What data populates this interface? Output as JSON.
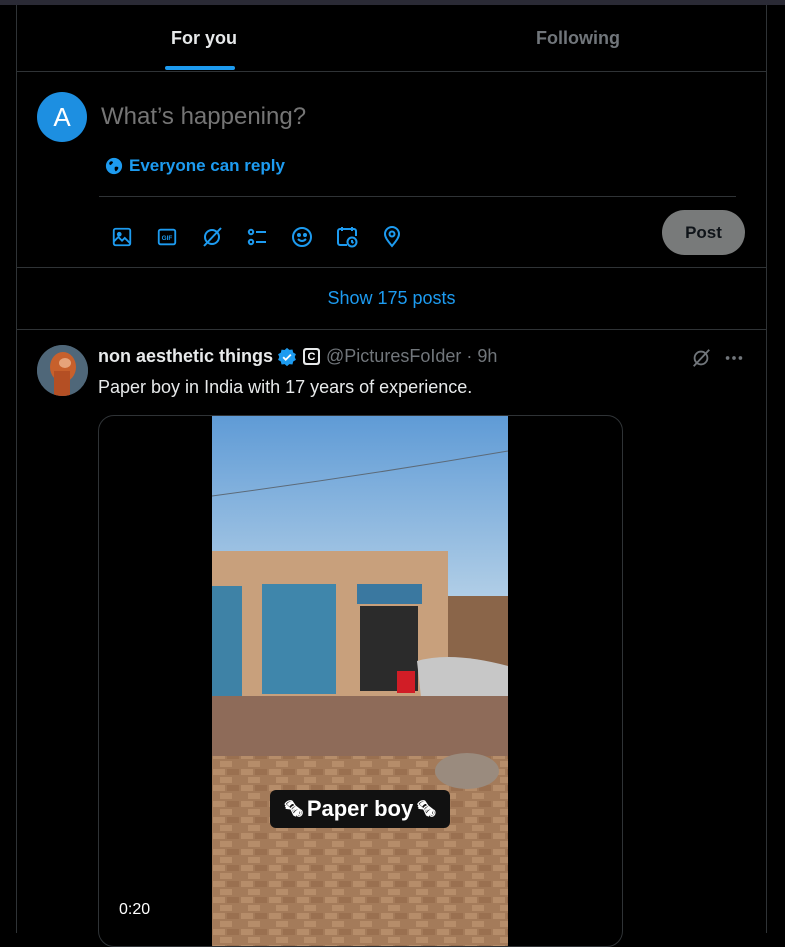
{
  "tabs": {
    "for_you": "For you",
    "following": "Following"
  },
  "composer": {
    "avatar_letter": "A",
    "placeholder": "What’s happening?",
    "reply_setting": "Everyone can reply",
    "post_label": "Post",
    "tools": [
      "image-icon",
      "gif-icon",
      "grok-icon",
      "poll-icon",
      "emoji-icon",
      "schedule-icon",
      "location-icon"
    ],
    "gif_text": "GIF"
  },
  "feed": {
    "show_posts": "Show 175 posts"
  },
  "tweet": {
    "name": "non aesthetic things",
    "badge_letter": "C",
    "handle": "@PicturesFoIder",
    "separator": "·",
    "time": "9h",
    "text": "Paper boy in India with 17 years of experience.",
    "video_caption": "Paper boy",
    "duration": "0:20"
  },
  "colors": {
    "accent": "#1d9bf0",
    "background": "#000000",
    "border": "#2f3336",
    "muted": "#71767b"
  }
}
